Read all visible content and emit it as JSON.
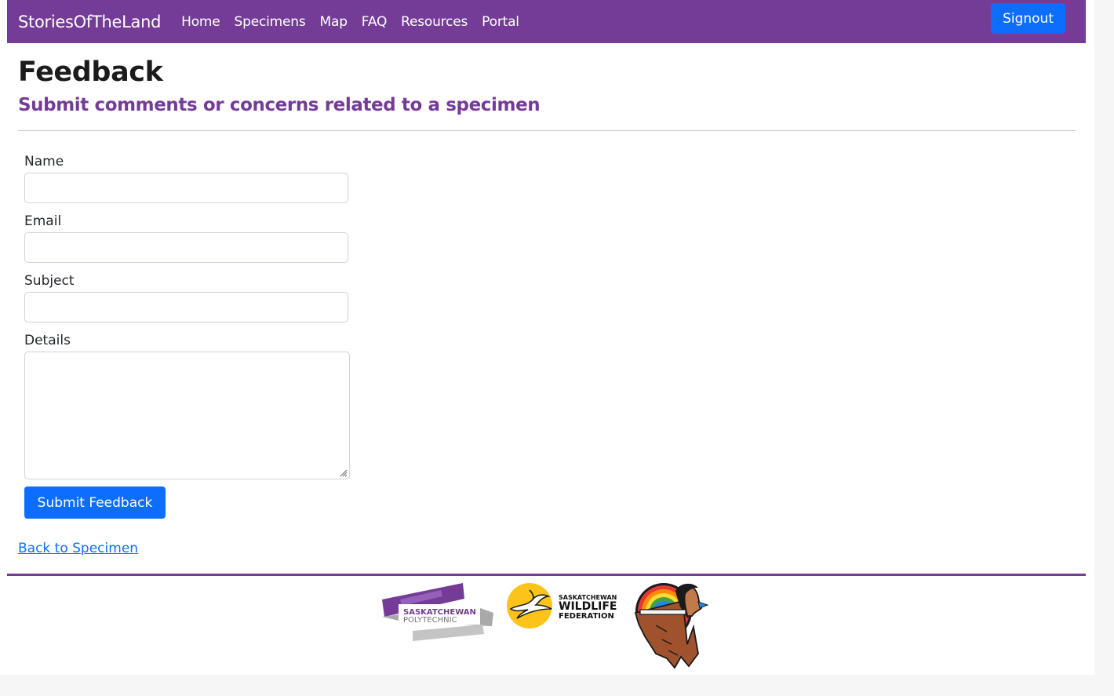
{
  "nav": {
    "brand": "StoriesOfTheLand",
    "links": [
      "Home",
      "Specimens",
      "Map",
      "FAQ",
      "Resources",
      "Portal"
    ],
    "signout": "Signout"
  },
  "header": {
    "title": "Feedback",
    "subtitle": "Submit comments or concerns related to a specimen"
  },
  "form": {
    "name_label": "Name",
    "name_value": "",
    "email_label": "Email",
    "email_value": "",
    "subject_label": "Subject",
    "subject_value": "",
    "details_label": "Details",
    "details_value": "",
    "submit_label": "Submit Feedback"
  },
  "back_link": "Back to Specimen",
  "footer": {
    "logos": [
      {
        "icon": "saskatchewan-polytechnic-logo",
        "line1": "SASKATCHEWAN",
        "line2": "POLYTECHNIC"
      },
      {
        "icon": "saskatchewan-wildlife-federation-logo",
        "line1": "SASKATCHEWAN",
        "line2": "WILDLIFE",
        "line3": "FEDERATION"
      },
      {
        "icon": "first-nations-emblem-logo"
      }
    ]
  },
  "colors": {
    "brand_purple": "#743c96",
    "primary_blue": "#0d6efd"
  }
}
